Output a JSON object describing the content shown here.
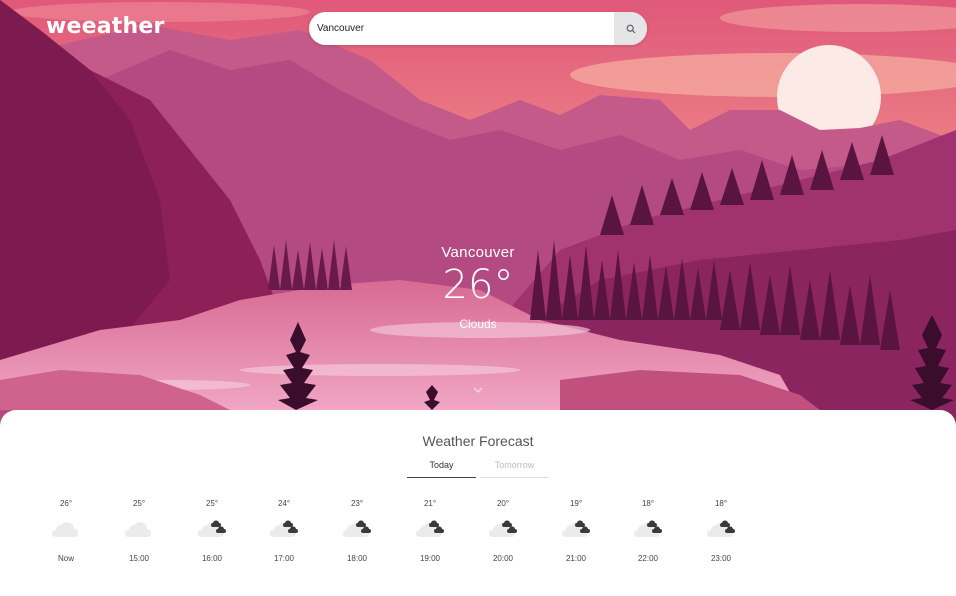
{
  "app": {
    "logo": "weeather"
  },
  "search": {
    "value": "Vancouver",
    "placeholder": ""
  },
  "current": {
    "city": "Vancouver",
    "temperature": "26°",
    "condition": "Clouds"
  },
  "forecast": {
    "title": "Weather Forecast",
    "tabs": [
      "Today",
      "Tomorrow"
    ],
    "active_tab": "Today",
    "hours": [
      {
        "temp": "26°",
        "time": "Now",
        "icon": "cloud-icon"
      },
      {
        "temp": "25°",
        "time": "15:00",
        "icon": "cloud-icon"
      },
      {
        "temp": "25°",
        "time": "16:00",
        "icon": "dark-clouds-icon"
      },
      {
        "temp": "24°",
        "time": "17:00",
        "icon": "dark-clouds-icon"
      },
      {
        "temp": "23°",
        "time": "18:00",
        "icon": "dark-clouds-icon"
      },
      {
        "temp": "21°",
        "time": "19:00",
        "icon": "dark-clouds-icon"
      },
      {
        "temp": "20°",
        "time": "20:00",
        "icon": "dark-clouds-icon"
      },
      {
        "temp": "19°",
        "time": "21:00",
        "icon": "dark-clouds-icon"
      },
      {
        "temp": "18°",
        "time": "22:00",
        "icon": "dark-clouds-icon"
      },
      {
        "temp": "18°",
        "time": "23:00",
        "icon": "dark-clouds-icon"
      }
    ]
  }
}
